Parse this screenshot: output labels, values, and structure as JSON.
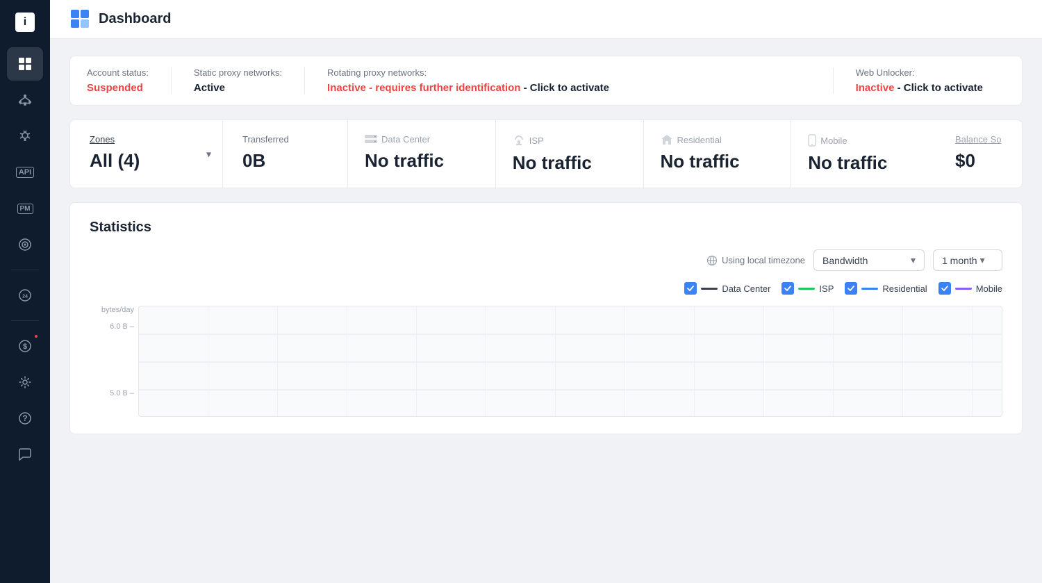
{
  "header": {
    "title": "Dashboard",
    "icon": "dashboard-icon"
  },
  "sidebar": {
    "items": [
      {
        "id": "logo",
        "icon": "i",
        "label": "Logo"
      },
      {
        "id": "dashboard",
        "icon": "⊞",
        "label": "Dashboard",
        "active": true
      },
      {
        "id": "proxies",
        "icon": "⠿",
        "label": "Proxies"
      },
      {
        "id": "scraper",
        "icon": "🕷",
        "label": "Scraper"
      },
      {
        "id": "api",
        "icon": "API",
        "label": "API"
      },
      {
        "id": "postman",
        "icon": "PM",
        "label": "Postman"
      },
      {
        "id": "target",
        "icon": "◎",
        "label": "Target"
      },
      {
        "id": "support",
        "icon": "24",
        "label": "Support"
      },
      {
        "id": "billing",
        "icon": "$",
        "label": "Billing"
      },
      {
        "id": "settings",
        "icon": "⚙",
        "label": "Settings"
      },
      {
        "id": "help",
        "icon": "?",
        "label": "Help"
      },
      {
        "id": "chat",
        "icon": "💬",
        "label": "Chat"
      }
    ]
  },
  "status_bar": {
    "account_status_label": "Account status:",
    "account_status_value": "Suspended",
    "static_proxy_label": "Static proxy networks:",
    "static_proxy_value": "Active",
    "rotating_proxy_label": "Rotating proxy networks:",
    "rotating_proxy_warn": "Inactive - requires further identification",
    "rotating_proxy_action": " - Click to activate",
    "web_unlocker_label": "Web Unlocker:",
    "web_unlocker_warn": "Inactive",
    "web_unlocker_action": " - Click to activate"
  },
  "stats": {
    "zones_label": "Zones",
    "zones_value": "All (4)",
    "transferred_label": "Transferred",
    "transferred_value": "0B",
    "traffic": [
      {
        "type": "Data Center",
        "value": "No traffic",
        "icon": "server-icon"
      },
      {
        "type": "ISP",
        "value": "No traffic",
        "icon": "isp-icon"
      },
      {
        "type": "Residential",
        "value": "No traffic",
        "icon": "home-icon"
      },
      {
        "type": "Mobile",
        "value": "No traffic",
        "icon": "mobile-icon"
      }
    ],
    "balance_label": "Balance So",
    "balance_value": "$0"
  },
  "statistics": {
    "title": "Statistics",
    "timezone_label": "Using local timezone",
    "bandwidth_label": "Bandwidth",
    "period_label": "1 month",
    "legend": [
      {
        "id": "dc",
        "label": "Data Center",
        "color": "#374151",
        "checked": true
      },
      {
        "id": "isp",
        "label": "ISP",
        "color": "#22c55e",
        "checked": true
      },
      {
        "id": "res",
        "label": "Residential",
        "color": "#3b82f6",
        "checked": true
      },
      {
        "id": "mob",
        "label": "Mobile",
        "color": "#8b5cf6",
        "checked": true
      }
    ],
    "chart": {
      "y_unit": "bytes/day",
      "y_labels": [
        "6.0 B",
        "5.0 B"
      ],
      "grid_lines": 6
    }
  }
}
